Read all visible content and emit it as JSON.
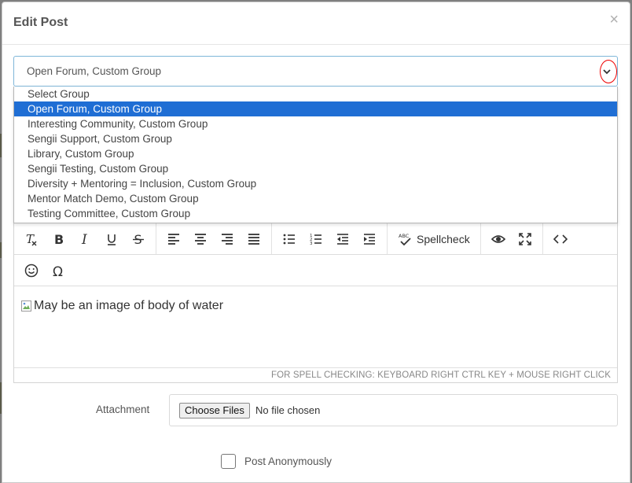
{
  "modal": {
    "title": "Edit Post",
    "close_glyph": "×"
  },
  "group_select": {
    "value": "Open Forum, Custom Group",
    "options": [
      "Select Group",
      "Open Forum, Custom Group",
      "Interesting Community, Custom Group",
      "Sengii Support, Custom Group",
      "Library, Custom Group",
      "Sengii Testing, Custom Group",
      "Diversity + Mentoring = Inclusion, Custom Group",
      "Mentor Match Demo, Custom Group",
      "Testing Committee, Custom Group"
    ],
    "selected_index": 1,
    "highlight_color": "#1f6ed4",
    "annotation_color": "#ee0000"
  },
  "toolbar": {
    "spellcheck_label": "Spellcheck",
    "icons": [
      "clear-format-icon",
      "bold-icon",
      "italic-icon",
      "underline-icon",
      "strikethrough-icon",
      "align-left-icon",
      "align-center-icon",
      "align-right-icon",
      "align-justify-icon",
      "bullet-list-icon",
      "numbered-list-icon",
      "outdent-icon",
      "indent-icon",
      "spellcheck-icon",
      "preview-eye-icon",
      "fullscreen-icon",
      "code-view-icon",
      "emoji-icon",
      "omega-icon"
    ]
  },
  "editor": {
    "image_alt": "May be an image of body of water",
    "status_hint": "FOR SPELL CHECKING: KEYBOARD RIGHT CTRL KEY + MOUSE RIGHT CLICK"
  },
  "attachment": {
    "label": "Attachment",
    "button_label": "Choose Files",
    "status": "No file chosen"
  },
  "anonymous": {
    "label": "Post Anonymously",
    "checked": false
  }
}
